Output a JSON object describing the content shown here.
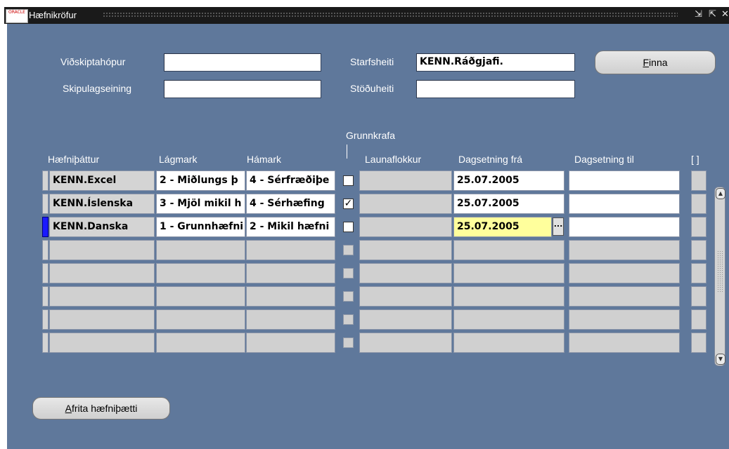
{
  "window": {
    "title": "Hæfnikröfur",
    "logo_text": "ORACLE",
    "controls": [
      "minimize",
      "maximize",
      "close"
    ]
  },
  "search": {
    "business_group_label": "Viðskiptahópur",
    "business_group_value": "",
    "organization_label": "Skipulagseining",
    "organization_value": "",
    "job_label": "Starfsheiti",
    "job_value": "KENN.Ráðgjafi.",
    "position_label": "Stöðuheiti",
    "position_value": "",
    "find_button": {
      "underline": "F",
      "rest": "inna"
    }
  },
  "grid": {
    "columns": {
      "competency": "Hæfniþáttur",
      "min": "Lágmark",
      "max": "Hámark",
      "essential": "Grunnkrafa",
      "grade": "Launaflokkur",
      "date_from": "Dagsetning frá",
      "date_to": "Dagsetning til",
      "flex": "[ ]"
    },
    "rows": [
      {
        "competency": "KENN.Excel",
        "min": "2 - Miðlungs þ",
        "max": "4 - Sérfræðiþe",
        "essential": "unchecked",
        "grade": "",
        "date_from": "25.07.2005",
        "date_to": "",
        "selected": false
      },
      {
        "competency": "KENN.Íslenska",
        "min": "3 - Mjöl mikil h",
        "max": "4 - Sérhæfing",
        "essential": "checked",
        "grade": "",
        "date_from": "25.07.2005",
        "date_to": "",
        "selected": false
      },
      {
        "competency": "KENN.Danska",
        "min": "1 - Grunnhæfni",
        "max": "2 - Mikil hæfni",
        "essential": "unchecked",
        "grade": "",
        "date_from": "25.07.2005",
        "date_to": "",
        "selected": true
      },
      {
        "competency": "",
        "min": "",
        "max": "",
        "essential": "disabled",
        "grade": "",
        "date_from": "",
        "date_to": "",
        "selected": false
      },
      {
        "competency": "",
        "min": "",
        "max": "",
        "essential": "disabled",
        "grade": "",
        "date_from": "",
        "date_to": "",
        "selected": false
      },
      {
        "competency": "",
        "min": "",
        "max": "",
        "essential": "disabled",
        "grade": "",
        "date_from": "",
        "date_to": "",
        "selected": false
      },
      {
        "competency": "",
        "min": "",
        "max": "",
        "essential": "disabled",
        "grade": "",
        "date_from": "",
        "date_to": "",
        "selected": false
      },
      {
        "competency": "",
        "min": "",
        "max": "",
        "essential": "disabled",
        "grade": "",
        "date_from": "",
        "date_to": "",
        "selected": false
      }
    ],
    "lov_button": "...",
    "check_glyph": "✓"
  },
  "copy_button": {
    "underline": "A",
    "rest": "frita hæfniþætti"
  },
  "colors": {
    "panel_bg": "#5f789b",
    "titlebar_bg": "#1a1a1a",
    "active_cell": "#ffff9c",
    "row_indicator": "#1a1aff"
  }
}
